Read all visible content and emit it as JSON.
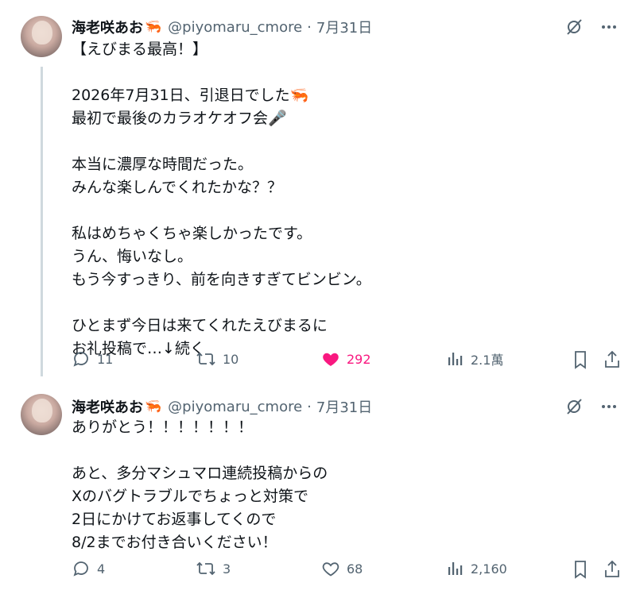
{
  "tweets": [
    {
      "author": {
        "name": "海老咲あお",
        "emoji": "🦐",
        "handle": "@piyomaru_cmore",
        "date": "7月31日"
      },
      "text": "【えびまる最高！】\n\n2026年7月31日、引退日でした🦐\n最初で最後のカラオケオフ会🎤\n\n本当に濃厚な時間だった。\nみんな楽しんでくれたかな？？\n\n私はめちゃくちゃ楽しかったです。\nうん、悔いなし。\nもう今すっきり、前を向きすぎてビンビン。\n\nひとまず今日は来てくれたえびまるに\nお礼投稿で…↓続く",
      "stats": {
        "replies": "11",
        "reposts": "10",
        "likes": "292",
        "views": "2.1萬"
      },
      "liked": true
    },
    {
      "author": {
        "name": "海老咲あお",
        "emoji": "🦐",
        "handle": "@piyomaru_cmore",
        "date": "7月31日"
      },
      "text": "ありがとう！！！！！！！\n\nあと、多分マシュマロ連続投稿からの\nXのバグトラブルでちょっと対策で\n2日にかけてお返事してくので\n8/2までお付き合いください！",
      "stats": {
        "replies": "4",
        "reposts": "3",
        "likes": "68",
        "views": "2,160"
      },
      "liked": false
    }
  ],
  "icons": {
    "reply": "reply-icon",
    "repost": "repost-icon",
    "like": "heart-icon",
    "views": "views-icon",
    "bookmark": "bookmark-icon",
    "share": "share-icon",
    "grok": "grok-icon",
    "more": "more-icon"
  },
  "colors": {
    "like_active": "#f91880",
    "muted": "#536471",
    "thread_line": "#cfd9de"
  }
}
